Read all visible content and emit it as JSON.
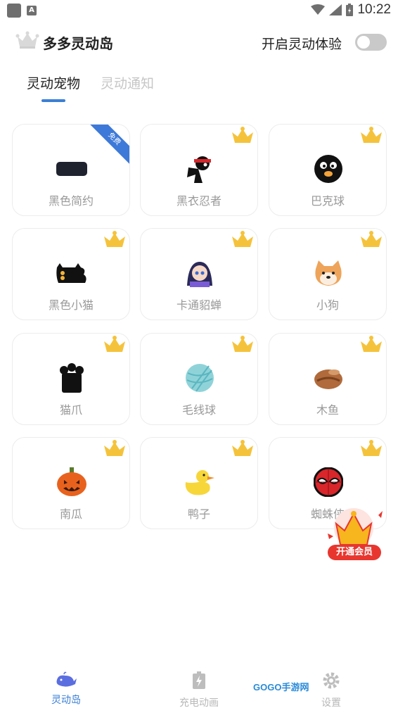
{
  "status_bar": {
    "time": "10:22"
  },
  "header": {
    "title": "多多灵动岛",
    "toggle_label": "开启灵动体验",
    "toggle_on": false
  },
  "tabs": [
    {
      "label": "灵动宠物",
      "active": true
    },
    {
      "label": "灵动通知",
      "active": false
    }
  ],
  "grid": {
    "items": [
      {
        "label": "黑色简约",
        "badge": "免费"
      },
      {
        "label": "黑衣忍者"
      },
      {
        "label": "巴克球"
      },
      {
        "label": "黑色小猫"
      },
      {
        "label": "卡通貂蝉"
      },
      {
        "label": "小狗"
      },
      {
        "label": "猫爪"
      },
      {
        "label": "毛线球"
      },
      {
        "label": "木鱼"
      },
      {
        "label": "南瓜"
      },
      {
        "label": "鸭子"
      },
      {
        "label": "蜘蛛侠"
      }
    ]
  },
  "vip_button": {
    "label": "开通会员"
  },
  "bottom_nav": [
    {
      "label": "灵动岛",
      "active": true
    },
    {
      "label": "充电动画",
      "active": false
    },
    {
      "label": "设置",
      "active": false
    }
  ],
  "watermark": "GOGO手游网",
  "colors": {
    "accent": "#3a7fd6",
    "vip": "#e8362f",
    "crown": "#f5c33b"
  }
}
